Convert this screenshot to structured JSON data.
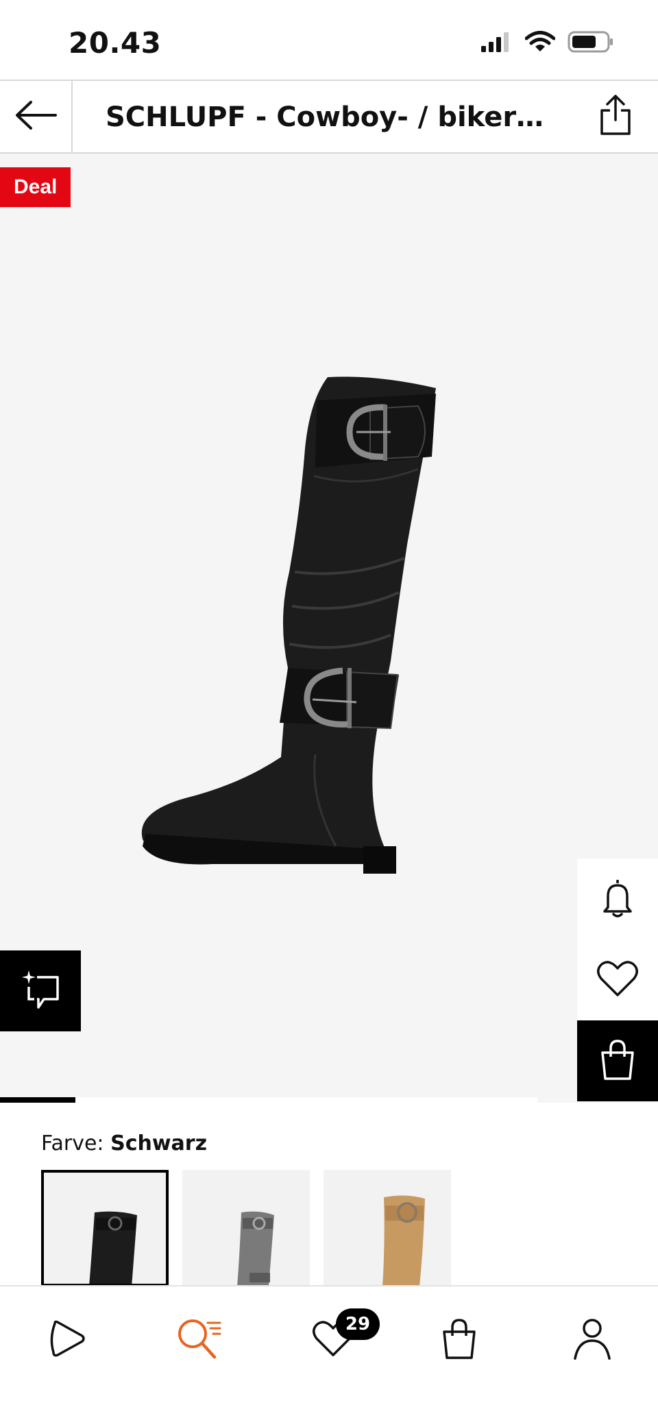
{
  "status_bar": {
    "time": "20.43",
    "icons": [
      "cellular-signal-icon",
      "wifi-icon",
      "battery-icon"
    ]
  },
  "header": {
    "back_icon": "arrow-left-icon",
    "title": "SCHLUPF - Cowboy- / bikerstøvler - schwarz",
    "share_icon": "share-icon"
  },
  "gallery": {
    "badge": "Deal",
    "image_icon": "black-knee-high-buckle-boot",
    "side_actions": [
      "bell-icon",
      "heart-icon",
      "shopping-bag-icon"
    ],
    "try_on_icon": "sparkle-frame-icon",
    "image_index_progress": 0.14
  },
  "color_select": {
    "label": "Farve:",
    "selected": "Schwarz",
    "options": [
      "black",
      "grey",
      "tan"
    ]
  },
  "bottom_nav": {
    "items": [
      "home-play-icon",
      "search-icon",
      "wishlist-heart-icon",
      "bag-icon",
      "profile-icon"
    ],
    "wishlist_count": "29",
    "active_color": "#e8641e"
  },
  "colors": {
    "deal_red": "#e30613",
    "accent_orange": "#e8641e",
    "black": "#000000",
    "gallery_bg": "#f5f5f5"
  }
}
